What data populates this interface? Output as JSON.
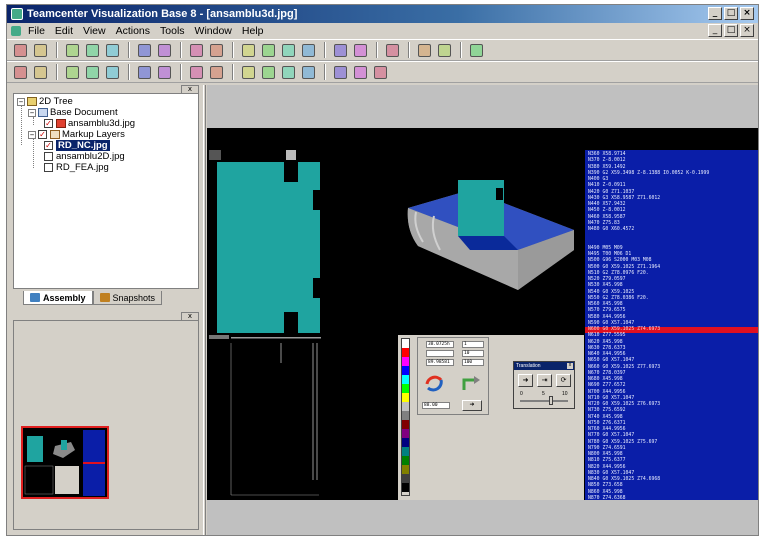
{
  "window": {
    "title": "Teamcenter Visualization Base 8 - [ansamblu3d.jpg]",
    "minimize": "_",
    "restore": "□",
    "close": "×"
  },
  "menu": {
    "items": [
      "File",
      "Edit",
      "View",
      "Actions",
      "Tools",
      "Window",
      "Help"
    ],
    "mdi_minimize": "_",
    "mdi_restore": "□",
    "mdi_close": "×"
  },
  "toolbar1": [
    "open-icon",
    "save-icon",
    "cut-icon",
    "copy-icon",
    "paste-icon",
    "undo-icon",
    "redo-icon",
    "print-icon",
    "find-icon",
    "assembly-icon",
    "part-icon",
    "gear-icon",
    "gear2-icon",
    "group-icon",
    "ungroup-icon",
    "monitor-icon",
    "select-icon",
    "zoom-icon",
    "page-icon"
  ],
  "toolbar2": [
    "grid-icon",
    "fit-icon",
    "line-icon",
    "rect-icon",
    "select-box-icon",
    "pan-icon",
    "vertical-pan-icon",
    "zoom-in-icon",
    "zoom-out-icon",
    "layer1-icon",
    "layer2-icon",
    "layer3-icon",
    "layer4-icon",
    "snapshot-icon",
    "view-icon",
    "view2-icon"
  ],
  "tree": {
    "close": "x",
    "root": "2D Tree",
    "base_document": "Base Document",
    "base_file": "ansamblu3d.jpg",
    "markup_layers": "Markup Layers",
    "layers": [
      {
        "label": "RD_NC.jpg",
        "checked": true,
        "selected": true
      },
      {
        "label": "ansamblu2D.jpg",
        "checked": false,
        "selected": false
      },
      {
        "label": "RD_FEA.jpg",
        "checked": false,
        "selected": false
      }
    ]
  },
  "panel_tabs": {
    "assembly": "Assembly",
    "snapshots": "Snapshots"
  },
  "thumb_panel": {
    "close": "x"
  },
  "nc_program": [
    "N360 X58.9714",
    "N370 Z-8.0012",
    "N380 X59.1492",
    "N390 G2 X59.3498 Z-8.1388 I0.0052 K-0.1999",
    "N400 G3",
    "N410 Z-0.0911",
    "N420 G0 Z71.1037",
    "N430 G3 X58.9587 Z71.6012",
    "N440 X57.9432",
    "N450 Z-8.0012",
    "N460 X58.9587",
    "N470 Z75.83",
    "N480 G0 X60.4572",
    "",
    "",
    "N490 M05 M09",
    "N495 T00 M06 D1",
    "N500 G96 S2000 M03 M08",
    "N500 G0 X59.1025 Z71.1964",
    "N510 G2 Z78.0976 F20.",
    "N520 Z79.0597",
    "N530 X45.998",
    "N540 G0 X59.1025",
    "N550 G2 Z78.0386 F20.",
    "N560 X45.998",
    "N570 Z79.6575",
    "N580 X44.9956",
    "N590 G0 X57.1047",
    "N600 G0 X59.1025 Z74.6973",
    "N610 Z77.5595",
    "N620 X45.998",
    "N630 Z78.6373",
    "N640 X44.9956",
    "N650 G0 X57.1047",
    "N660 G0 X59.1025 Z77.6973",
    "N670 Z78.0397",
    "N680 X45.998",
    "N690 Z77.6572",
    "N700 X44.9956",
    "N710 G0 X57.1047",
    "N720 G0 X59.1025 Z76.6973",
    "N730 Z75.6592",
    "N740 X45.998",
    "N750 Z76.6371",
    "N760 X44.9956",
    "N770 G0 X57.1047",
    "N780 G0 X59.1025 Z75.697",
    "N790 Z74.6591",
    "N800 X45.998",
    "N810 Z75.6377",
    "N820 X44.9956",
    "N830 G0 X57.1047",
    "N840 G0 X59.1025 Z74.6968",
    "N850 Z73.658",
    "N860 X45.998",
    "N870 Z74.6368",
    "N880 X44.9956",
    "N890 G0 X57.1047"
  ],
  "nc_highlight_index": 28,
  "dialog_mini": {
    "field1": "38.0725h",
    "field2": "1",
    "field3": "10",
    "field4": "89.98581",
    "field5": "100",
    "field6": "88.00"
  },
  "translation": {
    "title": "Translation",
    "close": "x",
    "scale_min": "0",
    "scale_mid": "5",
    "scale_max": "10"
  },
  "palette_colors": [
    "#ffffff",
    "#ff0000",
    "#ff00ff",
    "#0000ff",
    "#00ffff",
    "#00ff00",
    "#ffff00",
    "#c0c0c0",
    "#808080",
    "#800000",
    "#800080",
    "#000080",
    "#008080",
    "#008000",
    "#808000",
    "#404040",
    "#000000"
  ],
  "colors": {
    "teal": "#1fa4a0",
    "nc_background": "#0a1ea8",
    "highlight": "#e01020"
  }
}
